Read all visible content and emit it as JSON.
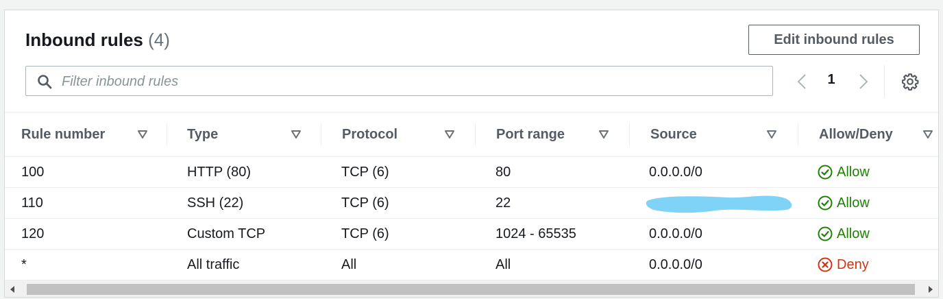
{
  "header": {
    "title": "Inbound rules",
    "count": "(4)",
    "edit_label": "Edit inbound rules"
  },
  "filter": {
    "placeholder": "Filter inbound rules"
  },
  "pagination": {
    "current_page": "1"
  },
  "columns": [
    "Rule number",
    "Type",
    "Protocol",
    "Port range",
    "Source",
    "Allow/Deny"
  ],
  "rows": [
    {
      "rule": "100",
      "type": "HTTP (80)",
      "protocol": "TCP (6)",
      "port": "80",
      "source": "0.0.0.0/0",
      "action": "Allow"
    },
    {
      "rule": "110",
      "type": "SSH (22)",
      "protocol": "TCP (6)",
      "port": "22",
      "source": "",
      "action": "Allow"
    },
    {
      "rule": "120",
      "type": "Custom TCP",
      "protocol": "TCP (6)",
      "port": "1024 - 65535",
      "source": "0.0.0.0/0",
      "action": "Allow"
    },
    {
      "rule": "*",
      "type": "All traffic",
      "protocol": "All",
      "port": "All",
      "source": "0.0.0.0/0",
      "action": "Deny"
    }
  ],
  "colors": {
    "allow": "#1d8102",
    "deny": "#d13212",
    "redaction": "#7fd3f7"
  },
  "icons": {
    "search": "search-icon",
    "settings": "gear-icon",
    "allow": "check-circle-icon",
    "deny": "x-circle-icon"
  }
}
